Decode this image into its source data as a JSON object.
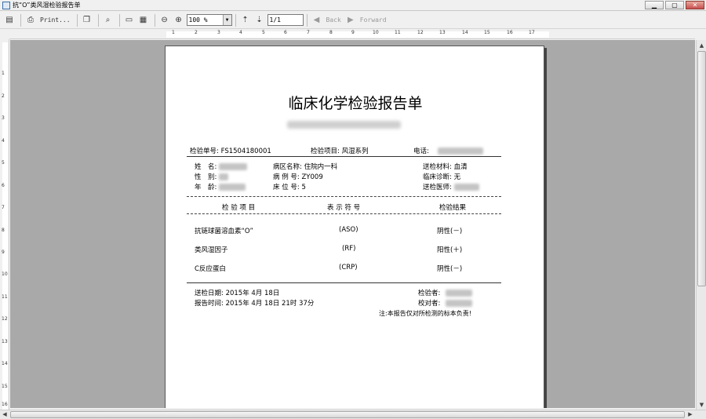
{
  "window": {
    "title": "抗“O”类风湿检验报告单",
    "btn_min": "▁",
    "btn_max": "▢",
    "btn_close": "✕"
  },
  "toolbar": {
    "print_label": "Print...",
    "zoom_value": "100 %",
    "page_value": "1/1",
    "back_label": "Back",
    "forward_label": "Forward"
  },
  "ruler": {
    "h_ticks": [
      "1",
      "2",
      "3",
      "4",
      "5",
      "6",
      "7",
      "8",
      "9",
      "10",
      "11",
      "12",
      "13",
      "14",
      "15",
      "16",
      "17"
    ],
    "v_ticks": [
      "1",
      "2",
      "3",
      "4",
      "5",
      "6",
      "7",
      "8",
      "9",
      "10",
      "11",
      "12",
      "13",
      "14",
      "15",
      "16"
    ]
  },
  "report": {
    "title": "临床化学检验报告单",
    "meta": {
      "no_label": "检验单号:",
      "no_value": "FS1504180001",
      "item_label": "检验项目:",
      "item_value": "风湿系列",
      "phone_label": "电话:"
    },
    "patient": {
      "name_label": "姓　名:",
      "sex_label": "性　别:",
      "age_label": "年　龄:",
      "ward_label": "病区名称:",
      "ward_value": "住院内一科",
      "case_label": "病 例 号:",
      "case_value": "ZY009",
      "bed_label": "床 位 号:",
      "bed_value": "5",
      "material_label": "送检材料:",
      "material_value": "血清",
      "diag_label": "临床诊断:",
      "diag_value": "无",
      "doctor_label": "送检医师:"
    },
    "table_headers": [
      "检 验 项 目",
      "表 示 符 号",
      "检验结果"
    ],
    "rows": [
      {
        "item": "抗链球菌溶血素“O”",
        "symbol": "(ASO)",
        "result": "阴性(－)"
      },
      {
        "item": "类风湿因子",
        "symbol": "(RF)",
        "result": "阳性(＋)"
      },
      {
        "item": "C反应蛋白",
        "symbol": "(CRP)",
        "result": "阴性(－)"
      }
    ],
    "footer": {
      "send_date": "送检日期: 2015年 4月 18日",
      "report_time": "报告时间: 2015年 4月 18日 21时 37分",
      "inspector_label": "检验者:",
      "checker_label": "校对者:",
      "note": "注:本报告仅对所检测的标本负责!"
    }
  }
}
